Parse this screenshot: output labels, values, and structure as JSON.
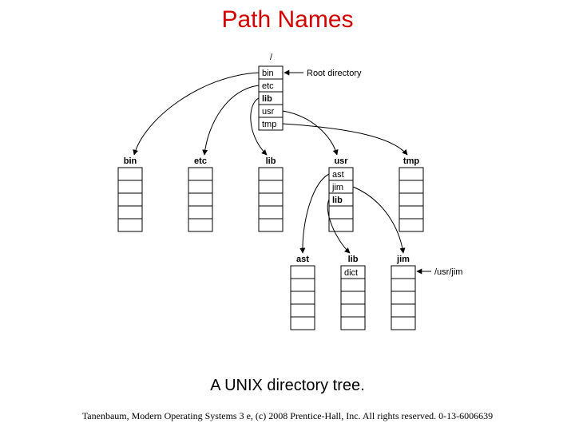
{
  "title": "Path Names",
  "caption": "A UNIX directory tree.",
  "footer": "Tanenbaum, Modern Operating Systems 3 e, (c) 2008 Prentice-Hall, Inc. All rights reserved. 0-13-6006639",
  "root_label": "/",
  "root_annot": "Root directory",
  "usrjim_annot": "/usr/jim",
  "root_entries": [
    "bin",
    "etc",
    "lib",
    "usr",
    "tmp"
  ],
  "level2": [
    "bin",
    "etc",
    "lib",
    "usr",
    "tmp"
  ],
  "usr_entries": [
    "ast",
    "jim",
    "lib"
  ],
  "level3": [
    "ast",
    "lib",
    "jim"
  ],
  "lib_entry": "dict"
}
